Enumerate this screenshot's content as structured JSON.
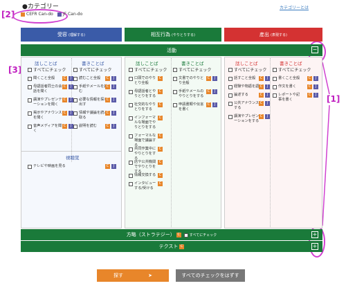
{
  "annotations": {
    "a1": "[1]",
    "a2": "[2]",
    "a3": "[3]"
  },
  "header": {
    "title": "●カテゴリー",
    "about_link": "カテゴリーとは"
  },
  "legend": {
    "cefr": "CEFR Can-do",
    "jf": "JF Can-do",
    "badge_c": "C",
    "badge_j": "J"
  },
  "categories": [
    {
      "label": "受容",
      "sub": "(理解する)",
      "color": "#3a5ba8"
    },
    {
      "label": "相互行為",
      "sub": "(やりとりする)",
      "color": "#1a7a3a"
    },
    {
      "label": "産出",
      "sub": "(表現する)",
      "color": "#d43232"
    }
  ],
  "activity": {
    "label": "活動",
    "toggle": "−"
  },
  "reception": {
    "speaking": "話しことば",
    "writing": "書きことば",
    "check_all": "すべてにチェック",
    "speaking_items": [
      "聞くこと全般",
      "母語話者同士の会話を聞く",
      "講演やプレゼンテーションを聞く",
      "掲示やアナウンスを聞く",
      "音声メディアを聞く"
    ],
    "writing_items": [
      "読むこと全般",
      "手紙やメールを読む",
      "必要な情報を探し出す",
      "情報や議論を読み取る",
      "説明を読む"
    ],
    "visual_title": "視聴覚",
    "visual_items": [
      "テレビや映画を見る"
    ]
  },
  "interaction": {
    "speaking": "話しことば",
    "writing": "書きことば",
    "check_all": "すべてにチェック",
    "speaking_items": [
      "口頭でのやりとり全般",
      "母語話者とやりとりをする",
      "社交的なやりとりをする",
      "インフォーマルな場面でやりとりをする",
      "フォーマルな場面で議論する",
      "共同作業中にやりとりをする",
      "店や公共機関でやりとりをする",
      "情報交換する",
      "インタビューする/受ける"
    ],
    "writing_items": [
      "文書でのやりとり全般",
      "手紙やメールのやりとりをする",
      "申請書類や伝言を書く"
    ]
  },
  "production": {
    "speaking": "話しことば",
    "writing": "書きことば",
    "check_all": "すべてにチェック",
    "speaking_items": [
      "話すこと全般",
      "経験や物語を語る",
      "論述する",
      "公共アナウンスをする",
      "講演やプレゼンテーションをする"
    ],
    "writing_items": [
      "書くこと全般",
      "作文を書く",
      "レポートや記事を書く"
    ]
  },
  "strategy": {
    "label": "方略（ストラテジー）",
    "check_all": "すべてにチェック",
    "toggle": "+"
  },
  "text": {
    "label": "テクスト",
    "toggle": "+"
  },
  "buttons": {
    "search": "探す",
    "search_arrow": "➤",
    "clear": "すべてのチェックをはずす"
  }
}
